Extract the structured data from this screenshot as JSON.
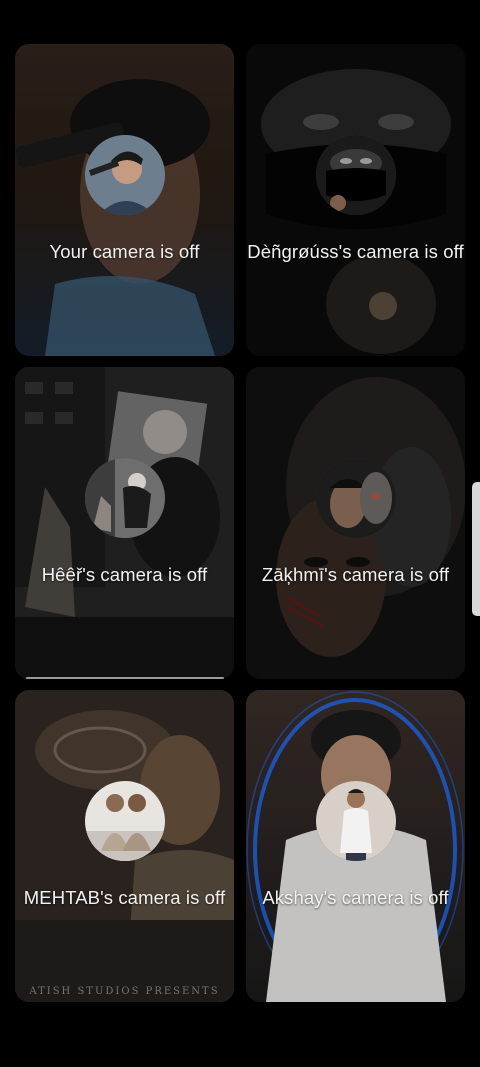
{
  "participants": [
    {
      "label": "Your camera is off"
    },
    {
      "label": "Dèñgrøúss's camera is off"
    },
    {
      "label": "Hêêř's camera is off"
    },
    {
      "label": "Zāķhmī's camera is off"
    },
    {
      "label": "MEHTAB's camera is off"
    },
    {
      "label": "Akshay's camera is off"
    }
  ],
  "overlay_text": {
    "studio_credit": "ATISH STUDIOS PRESENTS"
  },
  "colors": {
    "background": "#000000",
    "label_text": "#f2f2f2",
    "ring_accent": "#1f6fff"
  }
}
